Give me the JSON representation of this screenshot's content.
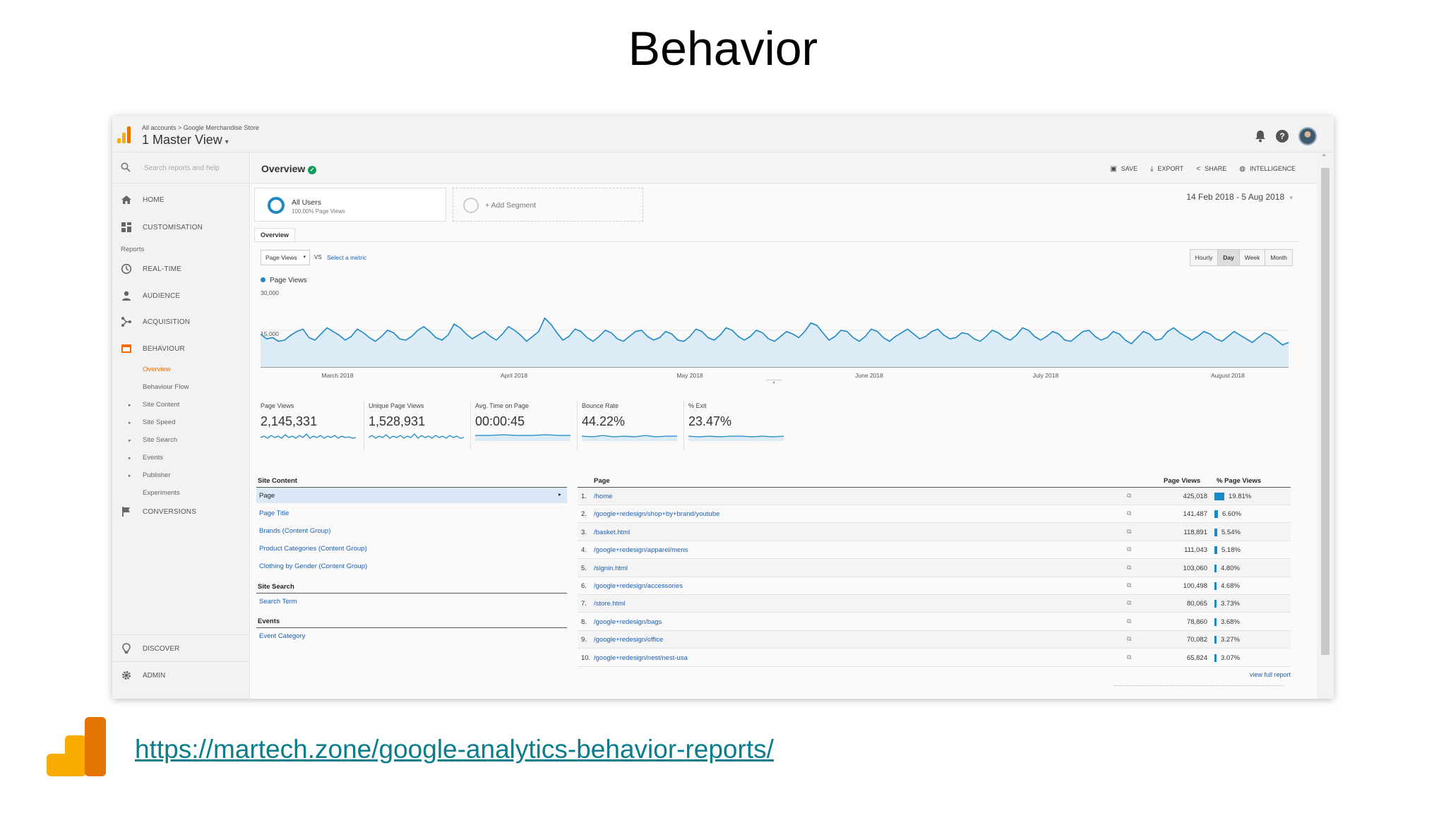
{
  "slide": {
    "title": "Behavior",
    "link": "https://martech.zone/google-analytics-behavior-reports/"
  },
  "topbar": {
    "breadcrumb": "All accounts > Google Merchandise Store",
    "view": "1 Master View",
    "view_caret": "▾"
  },
  "sidebar": {
    "search_placeholder": "Search reports and help",
    "home": "HOME",
    "customisation": "CUSTOMISATION",
    "reports_heading": "Reports",
    "realtime": "REAL-TIME",
    "audience": "AUDIENCE",
    "acquisition": "ACQUISITION",
    "behaviour": "BEHAVIOUR",
    "behaviour_items": [
      "Overview",
      "Behaviour Flow",
      "Site Content",
      "Site Speed",
      "Site Search",
      "Events",
      "Publisher",
      "Experiments"
    ],
    "conversions": "CONVERSIONS",
    "discover": "DISCOVER",
    "admin": "ADMIN"
  },
  "header": {
    "title": "Overview",
    "actions": [
      "SAVE",
      "EXPORT",
      "SHARE",
      "INTELLIGENCE"
    ]
  },
  "segments": {
    "active_name": "All Users",
    "active_sub": "100.00% Page Views",
    "add": "+ Add Segment"
  },
  "date_range": "14 Feb 2018 - 5 Aug 2018",
  "date_caret": "▾",
  "tab": "Overview",
  "chart_controls": {
    "metric": "Page Views",
    "metric_caret": "▾",
    "vs": "VS",
    "select_metric": "Select a metric",
    "granularity": [
      "Hourly",
      "Day",
      "Week",
      "Month"
    ],
    "selected": "Day"
  },
  "chart_data": {
    "type": "area",
    "series": [
      {
        "name": "Page Views",
        "values": [
          13500,
          11500,
          12000,
          10500,
          11000,
          13000,
          14500,
          15500,
          12000,
          11000,
          13500,
          16000,
          14500,
          13000,
          11000,
          12500,
          15500,
          14000,
          12000,
          10500,
          12500,
          15000,
          14000,
          11500,
          11000,
          12500,
          15000,
          16500,
          14500,
          12000,
          11000,
          13000,
          17500,
          16000,
          13500,
          11500,
          13000,
          14500,
          12500,
          11000,
          13500,
          16500,
          15000,
          13000,
          10500,
          12500,
          14500,
          20000,
          17500,
          14000,
          11000,
          12500,
          15500,
          14500,
          12000,
          10500,
          12500,
          15000,
          14000,
          11500,
          10500,
          12500,
          14500,
          15000,
          12500,
          11000,
          12000,
          14500,
          13500,
          11000,
          10500,
          12500,
          15500,
          14500,
          12000,
          11000,
          13000,
          16000,
          15000,
          12500,
          11000,
          12500,
          15000,
          14000,
          11500,
          10500,
          12500,
          14500,
          13500,
          12000,
          14500,
          18000,
          17000,
          14000,
          11000,
          12500,
          15000,
          14500,
          12000,
          10500,
          12500,
          15500,
          14500,
          12000,
          10500,
          12500,
          14000,
          15500,
          13500,
          11500,
          12500,
          14500,
          15500,
          13000,
          11500,
          12000,
          14000,
          13500,
          11500,
          10500,
          12500,
          15000,
          14000,
          12000,
          11000,
          13000,
          16000,
          15000,
          12500,
          11000,
          12500,
          14500,
          13500,
          11000,
          10500,
          12500,
          14500,
          15000,
          12500,
          11000,
          12000,
          14500,
          13500,
          11000,
          9500,
          12000,
          14500,
          13500,
          11000,
          11500,
          14500,
          16000,
          14000,
          12500,
          11000,
          12500,
          14500,
          13500,
          11500,
          10500,
          12500,
          14500,
          13000,
          11500,
          10000,
          12000,
          14000,
          13000,
          11000,
          9000,
          10000
        ],
        "color": "#1e88c7"
      }
    ],
    "y_ticks": [
      "30,000",
      "15,000"
    ],
    "ylim": [
      0,
      30000
    ],
    "x_ticks": [
      "March 2018",
      "April 2018",
      "May 2018",
      "June 2018",
      "July 2018",
      "August 2018"
    ],
    "x_range": [
      "14 Feb 2018",
      "5 Aug 2018"
    ],
    "grid": true
  },
  "scorecards": [
    {
      "label": "Page Views",
      "value": "2,145,331"
    },
    {
      "label": "Unique Page Views",
      "value": "1,528,931"
    },
    {
      "label": "Avg. Time on Page",
      "value": "00:00:45"
    },
    {
      "label": "Bounce Rate",
      "value": "44.22%"
    },
    {
      "label": "% Exit",
      "value": "23.47%"
    }
  ],
  "left_table": {
    "site_content_heading": "Site Content",
    "site_content": [
      "Page",
      "Page Title",
      "Brands (Content Group)",
      "Product Categories (Content Group)",
      "Clothing by Gender (Content Group)"
    ],
    "site_search_heading": "Site Search",
    "site_search": [
      "Search Term"
    ],
    "events_heading": "Events",
    "events": [
      "Event Category"
    ],
    "selected_arrow": "▸"
  },
  "right_table": {
    "col_page": "Page",
    "col_pv": "Page Views",
    "col_pct": "% Page Views",
    "rows": [
      {
        "n": "1.",
        "page": "/home",
        "pv": "425,018",
        "pct": "19.81%",
        "frac": 0.1981
      },
      {
        "n": "2.",
        "page": "/google+redesign/shop+by+brand/youtube",
        "pv": "141,487",
        "pct": "6.60%",
        "frac": 0.066
      },
      {
        "n": "3.",
        "page": "/basket.html",
        "pv": "118,891",
        "pct": "5.54%",
        "frac": 0.0554
      },
      {
        "n": "4.",
        "page": "/google+redesign/apparel/mens",
        "pv": "111,043",
        "pct": "5.18%",
        "frac": 0.0518
      },
      {
        "n": "5.",
        "page": "/signin.html",
        "pv": "103,060",
        "pct": "4.80%",
        "frac": 0.048
      },
      {
        "n": "6.",
        "page": "/google+redesign/accessories",
        "pv": "100,498",
        "pct": "4.68%",
        "frac": 0.0468
      },
      {
        "n": "7.",
        "page": "/store.html",
        "pv": "80,065",
        "pct": "3.73%",
        "frac": 0.0373
      },
      {
        "n": "8.",
        "page": "/google+redesign/bags",
        "pv": "78,860",
        "pct": "3.68%",
        "frac": 0.0368
      },
      {
        "n": "9.",
        "page": "/google+redesign/office",
        "pv": "70,082",
        "pct": "3.27%",
        "frac": 0.0327
      },
      {
        "n": "10.",
        "page": "/google+redesign/nest/nest-usa",
        "pv": "65,824",
        "pct": "3.07%",
        "frac": 0.0307
      }
    ],
    "view_full": "view full report"
  },
  "colors": {
    "accent": "#1e88c7",
    "active_nav": "#ef6c00",
    "link": "#1a5fb4",
    "footer_link": "#0a7d8c"
  }
}
